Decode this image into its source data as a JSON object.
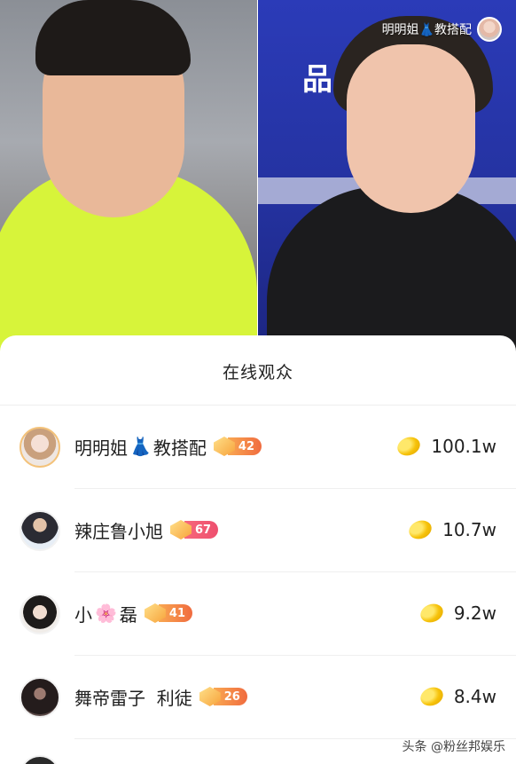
{
  "host": {
    "name": "明明姐👗教搭配",
    "avatar_icon": "host-avatar"
  },
  "backdrop_sign": "品",
  "panel": {
    "title": "在线观众"
  },
  "viewers": [
    {
      "name_prefix": "明明姐",
      "emoji": "👗",
      "name_suffix": "教搭配",
      "level": "42",
      "badge_color": "orange",
      "coins": "100.1w",
      "avatar_colors": [
        "#f5e0d6",
        "#c9a07d"
      ]
    },
    {
      "name_prefix": "辣庄鲁小旭",
      "emoji": "",
      "name_suffix": "",
      "level": "67",
      "badge_color": "red",
      "coins": "10.7w",
      "avatar_colors": [
        "#e7eef6",
        "#2b2b33"
      ]
    },
    {
      "name_prefix": "小",
      "emoji": "🌸",
      "name_suffix": "磊",
      "level": "41",
      "badge_color": "orange",
      "coins": "9.2w",
      "avatar_colors": [
        "#f0ece8",
        "#1d1b1a"
      ]
    },
    {
      "name_prefix": "舞帝雷子  利徒",
      "emoji": "",
      "name_suffix": "",
      "level": "26",
      "badge_color": "orange",
      "coins": "8.4w",
      "avatar_colors": [
        "#5b4a48",
        "#241c1c"
      ]
    }
  ],
  "watermark": "头条 @粉丝邦娱乐",
  "colors": {
    "accent_orange": "#f06b3f",
    "accent_red": "#ee4f6e",
    "coin_gold": "#f6c20a",
    "right_feed_blue": "#2432a0",
    "left_shirt_lime": "#d7f43a"
  }
}
